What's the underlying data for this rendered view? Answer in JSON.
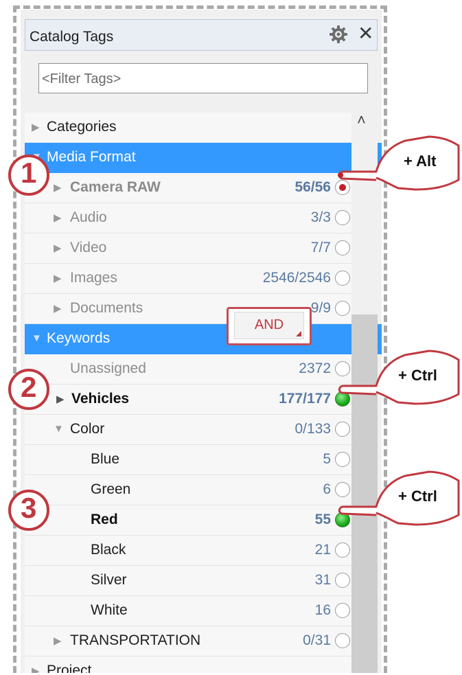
{
  "panel": {
    "title": "Catalog Tags",
    "filter_placeholder": "<Filter Tags>"
  },
  "tree": {
    "categories": {
      "label": "Categories"
    },
    "media_format": {
      "label": "Media Format",
      "items": [
        {
          "label": "Camera RAW",
          "count": "56/56",
          "state": "red"
        },
        {
          "label": "Audio",
          "count": "3/3",
          "state": "empty"
        },
        {
          "label": "Video",
          "count": "7/7",
          "state": "empty"
        },
        {
          "label": "Images",
          "count": "2546/2546",
          "state": "empty"
        },
        {
          "label": "Documents",
          "count": "9/9",
          "state": "empty"
        }
      ]
    },
    "keywords": {
      "label": "Keywords",
      "operator": "AND",
      "unassigned": {
        "label": "Unassigned",
        "count": "2372"
      },
      "vehicles": {
        "label": "Vehicles",
        "count": "177/177"
      },
      "color": {
        "label": "Color",
        "count": "0/133",
        "items": [
          {
            "label": "Blue",
            "count": "5"
          },
          {
            "label": "Green",
            "count": "6"
          },
          {
            "label": "Red",
            "count": "55"
          },
          {
            "label": "Black",
            "count": "21"
          },
          {
            "label": "Silver",
            "count": "31"
          },
          {
            "label": "White",
            "count": "16"
          }
        ]
      },
      "transportation": {
        "label": "TRANSPORTATION",
        "count": "0/31"
      }
    },
    "project": {
      "label": "Project"
    }
  },
  "annotations": {
    "step1": "1",
    "step2": "2",
    "step3": "3",
    "hint1": "+ Alt",
    "hint2": "+ Ctrl",
    "hint3": "+ Ctrl"
  },
  "colors": {
    "selection": "#3399ff",
    "annotation": "#c0383f",
    "radio_green": "#18a818",
    "radio_red": "#c0222a"
  },
  "icons": {
    "gear": "gear-icon",
    "close": "close-icon",
    "expand": "triangle-right-icon",
    "collapse": "triangle-down-icon",
    "scroll_up": "chevron-up-icon"
  }
}
